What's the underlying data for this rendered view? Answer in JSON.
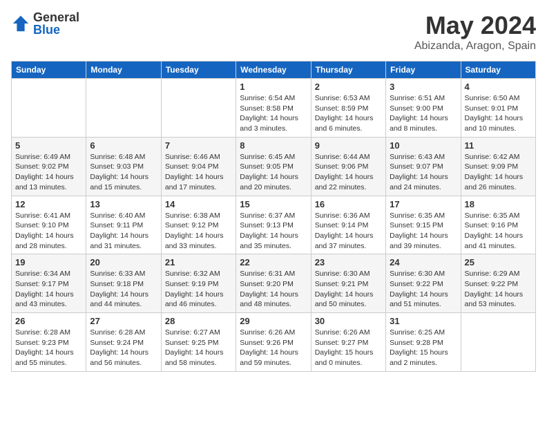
{
  "header": {
    "logo_general": "General",
    "logo_blue": "Blue",
    "month": "May 2024",
    "location": "Abizanda, Aragon, Spain"
  },
  "days_of_week": [
    "Sunday",
    "Monday",
    "Tuesday",
    "Wednesday",
    "Thursday",
    "Friday",
    "Saturday"
  ],
  "weeks": [
    [
      {
        "day": "",
        "info": ""
      },
      {
        "day": "",
        "info": ""
      },
      {
        "day": "",
        "info": ""
      },
      {
        "day": "1",
        "info": "Sunrise: 6:54 AM\nSunset: 8:58 PM\nDaylight: 14 hours\nand 3 minutes."
      },
      {
        "day": "2",
        "info": "Sunrise: 6:53 AM\nSunset: 8:59 PM\nDaylight: 14 hours\nand 6 minutes."
      },
      {
        "day": "3",
        "info": "Sunrise: 6:51 AM\nSunset: 9:00 PM\nDaylight: 14 hours\nand 8 minutes."
      },
      {
        "day": "4",
        "info": "Sunrise: 6:50 AM\nSunset: 9:01 PM\nDaylight: 14 hours\nand 10 minutes."
      }
    ],
    [
      {
        "day": "5",
        "info": "Sunrise: 6:49 AM\nSunset: 9:02 PM\nDaylight: 14 hours\nand 13 minutes."
      },
      {
        "day": "6",
        "info": "Sunrise: 6:48 AM\nSunset: 9:03 PM\nDaylight: 14 hours\nand 15 minutes."
      },
      {
        "day": "7",
        "info": "Sunrise: 6:46 AM\nSunset: 9:04 PM\nDaylight: 14 hours\nand 17 minutes."
      },
      {
        "day": "8",
        "info": "Sunrise: 6:45 AM\nSunset: 9:05 PM\nDaylight: 14 hours\nand 20 minutes."
      },
      {
        "day": "9",
        "info": "Sunrise: 6:44 AM\nSunset: 9:06 PM\nDaylight: 14 hours\nand 22 minutes."
      },
      {
        "day": "10",
        "info": "Sunrise: 6:43 AM\nSunset: 9:07 PM\nDaylight: 14 hours\nand 24 minutes."
      },
      {
        "day": "11",
        "info": "Sunrise: 6:42 AM\nSunset: 9:09 PM\nDaylight: 14 hours\nand 26 minutes."
      }
    ],
    [
      {
        "day": "12",
        "info": "Sunrise: 6:41 AM\nSunset: 9:10 PM\nDaylight: 14 hours\nand 28 minutes."
      },
      {
        "day": "13",
        "info": "Sunrise: 6:40 AM\nSunset: 9:11 PM\nDaylight: 14 hours\nand 31 minutes."
      },
      {
        "day": "14",
        "info": "Sunrise: 6:38 AM\nSunset: 9:12 PM\nDaylight: 14 hours\nand 33 minutes."
      },
      {
        "day": "15",
        "info": "Sunrise: 6:37 AM\nSunset: 9:13 PM\nDaylight: 14 hours\nand 35 minutes."
      },
      {
        "day": "16",
        "info": "Sunrise: 6:36 AM\nSunset: 9:14 PM\nDaylight: 14 hours\nand 37 minutes."
      },
      {
        "day": "17",
        "info": "Sunrise: 6:35 AM\nSunset: 9:15 PM\nDaylight: 14 hours\nand 39 minutes."
      },
      {
        "day": "18",
        "info": "Sunrise: 6:35 AM\nSunset: 9:16 PM\nDaylight: 14 hours\nand 41 minutes."
      }
    ],
    [
      {
        "day": "19",
        "info": "Sunrise: 6:34 AM\nSunset: 9:17 PM\nDaylight: 14 hours\nand 43 minutes."
      },
      {
        "day": "20",
        "info": "Sunrise: 6:33 AM\nSunset: 9:18 PM\nDaylight: 14 hours\nand 44 minutes."
      },
      {
        "day": "21",
        "info": "Sunrise: 6:32 AM\nSunset: 9:19 PM\nDaylight: 14 hours\nand 46 minutes."
      },
      {
        "day": "22",
        "info": "Sunrise: 6:31 AM\nSunset: 9:20 PM\nDaylight: 14 hours\nand 48 minutes."
      },
      {
        "day": "23",
        "info": "Sunrise: 6:30 AM\nSunset: 9:21 PM\nDaylight: 14 hours\nand 50 minutes."
      },
      {
        "day": "24",
        "info": "Sunrise: 6:30 AM\nSunset: 9:22 PM\nDaylight: 14 hours\nand 51 minutes."
      },
      {
        "day": "25",
        "info": "Sunrise: 6:29 AM\nSunset: 9:22 PM\nDaylight: 14 hours\nand 53 minutes."
      }
    ],
    [
      {
        "day": "26",
        "info": "Sunrise: 6:28 AM\nSunset: 9:23 PM\nDaylight: 14 hours\nand 55 minutes."
      },
      {
        "day": "27",
        "info": "Sunrise: 6:28 AM\nSunset: 9:24 PM\nDaylight: 14 hours\nand 56 minutes."
      },
      {
        "day": "28",
        "info": "Sunrise: 6:27 AM\nSunset: 9:25 PM\nDaylight: 14 hours\nand 58 minutes."
      },
      {
        "day": "29",
        "info": "Sunrise: 6:26 AM\nSunset: 9:26 PM\nDaylight: 14 hours\nand 59 minutes."
      },
      {
        "day": "30",
        "info": "Sunrise: 6:26 AM\nSunset: 9:27 PM\nDaylight: 15 hours\nand 0 minutes."
      },
      {
        "day": "31",
        "info": "Sunrise: 6:25 AM\nSunset: 9:28 PM\nDaylight: 15 hours\nand 2 minutes."
      },
      {
        "day": "",
        "info": ""
      }
    ]
  ]
}
